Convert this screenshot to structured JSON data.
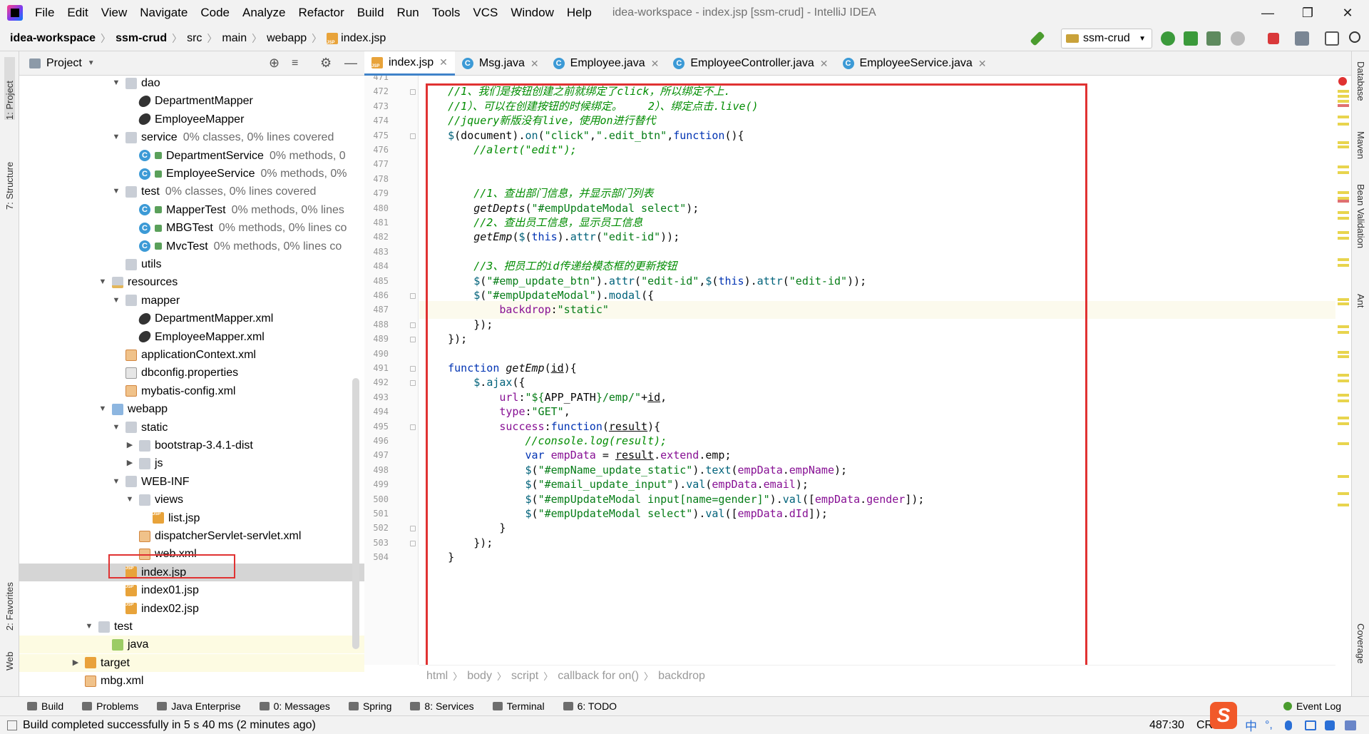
{
  "menu": {
    "items": [
      "File",
      "Edit",
      "View",
      "Navigate",
      "Code",
      "Analyze",
      "Refactor",
      "Build",
      "Run",
      "Tools",
      "VCS",
      "Window",
      "Help"
    ],
    "window_title": "idea-workspace - index.jsp [ssm-crud] - IntelliJ IDEA"
  },
  "nav": {
    "breadcrumb": [
      "idea-workspace",
      "ssm-crud",
      "src",
      "main",
      "webapp",
      "index.jsp"
    ],
    "run_config": "ssm-crud"
  },
  "left_strip": {
    "project": "1: Project",
    "structure": "7: Structure",
    "favorites": "2: Favorites",
    "web": "Web"
  },
  "right_strip": {
    "database": "Database",
    "maven": "Maven",
    "bean_validation": "Bean Validation",
    "ant": "Ant",
    "coverage": "Coverage"
  },
  "project_panel": {
    "title": "Project",
    "rows": [
      {
        "indent": 1,
        "arrow": "down",
        "icon": "folder",
        "label": "dao",
        "meta": ""
      },
      {
        "indent": 2,
        "arrow": "",
        "icon": "mapper",
        "label": "DepartmentMapper",
        "meta": ""
      },
      {
        "indent": 2,
        "arrow": "",
        "icon": "mapper",
        "label": "EmployeeMapper",
        "meta": ""
      },
      {
        "indent": 1,
        "arrow": "down",
        "icon": "folder",
        "label": "service",
        "meta": "0% classes, 0% lines covered"
      },
      {
        "indent": 2,
        "arrow": "",
        "icon": "class",
        "label": "DepartmentService",
        "meta": "0% methods, 0"
      },
      {
        "indent": 2,
        "arrow": "",
        "icon": "class",
        "label": "EmployeeService",
        "meta": "0% methods, 0%"
      },
      {
        "indent": 1,
        "arrow": "down",
        "icon": "folder",
        "label": "test",
        "meta": "0% classes, 0% lines covered"
      },
      {
        "indent": 2,
        "arrow": "",
        "icon": "class",
        "label": "MapperTest",
        "meta": "0% methods, 0% lines"
      },
      {
        "indent": 2,
        "arrow": "",
        "icon": "class",
        "label": "MBGTest",
        "meta": "0% methods, 0% lines co"
      },
      {
        "indent": 2,
        "arrow": "",
        "icon": "class",
        "label": "MvcTest",
        "meta": "0% methods, 0% lines co"
      },
      {
        "indent": 1,
        "arrow": "",
        "icon": "folder",
        "label": "utils",
        "meta": ""
      },
      {
        "indent": 0,
        "arrow": "down",
        "icon": "folder-res",
        "label": "resources",
        "meta": ""
      },
      {
        "indent": 1,
        "arrow": "down",
        "icon": "folder",
        "label": "mapper",
        "meta": ""
      },
      {
        "indent": 2,
        "arrow": "",
        "icon": "mapper",
        "label": "DepartmentMapper.xml",
        "meta": ""
      },
      {
        "indent": 2,
        "arrow": "",
        "icon": "mapper",
        "label": "EmployeeMapper.xml",
        "meta": ""
      },
      {
        "indent": 1,
        "arrow": "",
        "icon": "xml",
        "label": "applicationContext.xml",
        "meta": ""
      },
      {
        "indent": 1,
        "arrow": "",
        "icon": "props",
        "label": "dbconfig.properties",
        "meta": ""
      },
      {
        "indent": 1,
        "arrow": "",
        "icon": "xml",
        "label": "mybatis-config.xml",
        "meta": ""
      },
      {
        "indent": 0,
        "arrow": "down",
        "icon": "folder-src",
        "label": "webapp",
        "meta": ""
      },
      {
        "indent": 1,
        "arrow": "down",
        "icon": "folder",
        "label": "static",
        "meta": ""
      },
      {
        "indent": 2,
        "arrow": "right",
        "icon": "folder",
        "label": "bootstrap-3.4.1-dist",
        "meta": ""
      },
      {
        "indent": 2,
        "arrow": "right",
        "icon": "folder",
        "label": "js",
        "meta": ""
      },
      {
        "indent": 1,
        "arrow": "down",
        "icon": "folder",
        "label": "WEB-INF",
        "meta": ""
      },
      {
        "indent": 2,
        "arrow": "down",
        "icon": "folder",
        "label": "views",
        "meta": ""
      },
      {
        "indent": 3,
        "arrow": "",
        "icon": "jsp",
        "label": "list.jsp",
        "meta": ""
      },
      {
        "indent": 2,
        "arrow": "",
        "icon": "xml",
        "label": "dispatcherServlet-servlet.xml",
        "meta": ""
      },
      {
        "indent": 2,
        "arrow": "",
        "icon": "xml",
        "label": "web.xml",
        "meta": ""
      },
      {
        "indent": 1,
        "arrow": "",
        "icon": "jsp",
        "label": "index.jsp",
        "meta": "",
        "selected": true
      },
      {
        "indent": 1,
        "arrow": "",
        "icon": "jsp",
        "label": "index01.jsp",
        "meta": ""
      },
      {
        "indent": 1,
        "arrow": "",
        "icon": "jsp",
        "label": "index02.jsp",
        "meta": ""
      },
      {
        "indent": -1,
        "arrow": "down",
        "icon": "folder",
        "label": "test",
        "meta": ""
      },
      {
        "indent": 0,
        "arrow": "",
        "icon": "folder-green",
        "label": "java",
        "meta": "",
        "green": true
      },
      {
        "indent": -2,
        "arrow": "right",
        "icon": "folder-orange",
        "label": "target",
        "meta": "",
        "green": true
      },
      {
        "indent": -2,
        "arrow": "",
        "icon": "xml",
        "label": "mbg.xml",
        "meta": ""
      }
    ]
  },
  "tabs": [
    {
      "label": "index.jsp",
      "icon": "jsp",
      "active": true
    },
    {
      "label": "Msg.java",
      "icon": "class",
      "active": false
    },
    {
      "label": "Employee.java",
      "icon": "class",
      "active": false
    },
    {
      "label": "EmployeeController.java",
      "icon": "class",
      "active": false
    },
    {
      "label": "EmployeeService.java",
      "icon": "class",
      "active": false
    }
  ],
  "editor": {
    "current_line": 487,
    "lines": [
      {
        "n": "471",
        "t": [
          [
            "tx",
            ""
          ]
        ]
      },
      {
        "n": "472",
        "t": [
          [
            "cm",
            "    //1、我们是按钮创建之前就绑定了click，所以绑定不上."
          ]
        ]
      },
      {
        "n": "473",
        "t": [
          [
            "cm",
            "    //1）、可以在创建按钮的时候绑定。    2）、绑定点击.live()"
          ]
        ]
      },
      {
        "n": "474",
        "t": [
          [
            "cm",
            "    //jquery新版没有live，使用on进行替代"
          ]
        ]
      },
      {
        "n": "475",
        "t": [
          [
            "fn",
            "    $"
          ],
          [
            "tx",
            "(document)."
          ],
          [
            "fn",
            "on"
          ],
          [
            "tx",
            "("
          ],
          [
            "str",
            "\"click\""
          ],
          [
            "tx",
            ","
          ],
          [
            "str",
            "\".edit_btn\""
          ],
          [
            "tx",
            ","
          ],
          [
            "kw",
            "function"
          ],
          [
            "tx",
            "(){"
          ]
        ]
      },
      {
        "n": "476",
        "t": [
          [
            "cm",
            "        //alert(\"edit\");"
          ]
        ]
      },
      {
        "n": "477",
        "t": [
          [
            "tx",
            ""
          ]
        ]
      },
      {
        "n": "478",
        "t": [
          [
            "tx",
            ""
          ]
        ]
      },
      {
        "n": "479",
        "t": [
          [
            "cm",
            "        //1、查出部门信息，并显示部门列表"
          ]
        ]
      },
      {
        "n": "480",
        "t": [
          [
            "tx",
            "        "
          ],
          [
            "it",
            "getDepts"
          ],
          [
            "tx",
            "("
          ],
          [
            "str",
            "\"#empUpdateModal select\""
          ],
          [
            "tx",
            ");"
          ]
        ]
      },
      {
        "n": "481",
        "t": [
          [
            "cm",
            "        //2、查出员工信息，显示员工信息"
          ]
        ]
      },
      {
        "n": "482",
        "t": [
          [
            "tx",
            "        "
          ],
          [
            "it",
            "getEmp"
          ],
          [
            "tx",
            "("
          ],
          [
            "fn",
            "$"
          ],
          [
            "tx",
            "("
          ],
          [
            "kw",
            "this"
          ],
          [
            "tx",
            ")."
          ],
          [
            "fn",
            "attr"
          ],
          [
            "tx",
            "("
          ],
          [
            "str",
            "\"edit-id\""
          ],
          [
            "tx",
            "));"
          ]
        ]
      },
      {
        "n": "483",
        "t": [
          [
            "tx",
            ""
          ]
        ]
      },
      {
        "n": "484",
        "t": [
          [
            "cm",
            "        //3、把员工的id传递给模态框的更新按钮"
          ]
        ]
      },
      {
        "n": "485",
        "t": [
          [
            "fn",
            "        $"
          ],
          [
            "tx",
            "("
          ],
          [
            "str",
            "\"#emp_update_btn\""
          ],
          [
            "tx",
            ")."
          ],
          [
            "fn",
            "attr"
          ],
          [
            "tx",
            "("
          ],
          [
            "str",
            "\"edit-id\""
          ],
          [
            "tx",
            ","
          ],
          [
            "fn",
            "$"
          ],
          [
            "tx",
            "("
          ],
          [
            "kw",
            "this"
          ],
          [
            "tx",
            ")."
          ],
          [
            "fn",
            "attr"
          ],
          [
            "tx",
            "("
          ],
          [
            "str",
            "\"edit-id\""
          ],
          [
            "tx",
            "));"
          ]
        ]
      },
      {
        "n": "486",
        "t": [
          [
            "fn",
            "        $"
          ],
          [
            "tx",
            "("
          ],
          [
            "str",
            "\"#empUpdateModal\""
          ],
          [
            "tx",
            ")."
          ],
          [
            "fn",
            "modal"
          ],
          [
            "tx",
            "({"
          ]
        ]
      },
      {
        "n": "487",
        "t": [
          [
            "tx",
            "            "
          ],
          [
            "mb",
            "backdrop"
          ],
          [
            "tx",
            ":"
          ],
          [
            "str",
            "\"static\""
          ]
        ]
      },
      {
        "n": "488",
        "t": [
          [
            "tx",
            "        });"
          ]
        ]
      },
      {
        "n": "489",
        "t": [
          [
            "tx",
            "    });"
          ]
        ]
      },
      {
        "n": "490",
        "t": [
          [
            "tx",
            ""
          ]
        ]
      },
      {
        "n": "491",
        "t": [
          [
            "kw",
            "    function "
          ],
          [
            "it",
            "getEmp"
          ],
          [
            "tx",
            "("
          ],
          [
            "ul",
            "id"
          ],
          [
            "tx",
            "){"
          ]
        ]
      },
      {
        "n": "492",
        "t": [
          [
            "fn",
            "        $"
          ],
          [
            "tx",
            "."
          ],
          [
            "fn",
            "ajax"
          ],
          [
            "tx",
            "({"
          ]
        ]
      },
      {
        "n": "493",
        "t": [
          [
            "mb",
            "            url"
          ],
          [
            "tx",
            ":"
          ],
          [
            "str",
            "\"${"
          ],
          [
            "tx",
            "APP_PATH"
          ],
          [
            "str",
            "}/emp/\""
          ],
          [
            "tx",
            "+"
          ],
          [
            "ul",
            "id"
          ],
          [
            "tx",
            ","
          ]
        ]
      },
      {
        "n": "494",
        "t": [
          [
            "mb",
            "            type"
          ],
          [
            "tx",
            ":"
          ],
          [
            "str",
            "\"GET\""
          ],
          [
            "tx",
            ","
          ]
        ]
      },
      {
        "n": "495",
        "t": [
          [
            "mb",
            "            success"
          ],
          [
            "tx",
            ":"
          ],
          [
            "kw",
            "function"
          ],
          [
            "tx",
            "("
          ],
          [
            "ul",
            "result"
          ],
          [
            "tx",
            "){"
          ]
        ]
      },
      {
        "n": "496",
        "t": [
          [
            "cm",
            "                //console.log(result);"
          ]
        ]
      },
      {
        "n": "497",
        "t": [
          [
            "kw",
            "                var "
          ],
          [
            "mb",
            "empData"
          ],
          [
            "tx",
            " = "
          ],
          [
            "ul",
            "result"
          ],
          [
            "tx",
            "."
          ],
          [
            "mb",
            "extend"
          ],
          [
            "tx",
            ".emp;"
          ]
        ]
      },
      {
        "n": "498",
        "t": [
          [
            "fn",
            "                $"
          ],
          [
            "tx",
            "("
          ],
          [
            "str",
            "\"#empName_update_static\""
          ],
          [
            "tx",
            ")."
          ],
          [
            "fn",
            "text"
          ],
          [
            "tx",
            "("
          ],
          [
            "mb",
            "empData"
          ],
          [
            "tx",
            "."
          ],
          [
            "mb",
            "empName"
          ],
          [
            "tx",
            ");"
          ]
        ]
      },
      {
        "n": "499",
        "t": [
          [
            "fn",
            "                $"
          ],
          [
            "tx",
            "("
          ],
          [
            "str",
            "\"#email_update_input\""
          ],
          [
            "tx",
            ")."
          ],
          [
            "fn",
            "val"
          ],
          [
            "tx",
            "("
          ],
          [
            "mb",
            "empData"
          ],
          [
            "tx",
            "."
          ],
          [
            "mb",
            "email"
          ],
          [
            "tx",
            ");"
          ]
        ]
      },
      {
        "n": "500",
        "t": [
          [
            "fn",
            "                $"
          ],
          [
            "tx",
            "("
          ],
          [
            "str",
            "\"#empUpdateModal input[name=gender]\""
          ],
          [
            "tx",
            ")."
          ],
          [
            "fn",
            "val"
          ],
          [
            "tx",
            "(["
          ],
          [
            "mb",
            "empData"
          ],
          [
            "tx",
            "."
          ],
          [
            "mb",
            "gender"
          ],
          [
            "tx",
            "]);"
          ]
        ]
      },
      {
        "n": "501",
        "t": [
          [
            "fn",
            "                $"
          ],
          [
            "tx",
            "("
          ],
          [
            "str",
            "\"#empUpdateModal select\""
          ],
          [
            "tx",
            ")."
          ],
          [
            "fn",
            "val"
          ],
          [
            "tx",
            "(["
          ],
          [
            "mb",
            "empData"
          ],
          [
            "tx",
            "."
          ],
          [
            "mb",
            "dId"
          ],
          [
            "tx",
            "]);"
          ]
        ]
      },
      {
        "n": "502",
        "t": [
          [
            "tx",
            "            }"
          ]
        ]
      },
      {
        "n": "503",
        "t": [
          [
            "tx",
            "        });"
          ]
        ]
      },
      {
        "n": "504",
        "t": [
          [
            "tx",
            "    }"
          ]
        ]
      }
    ],
    "breadcrumb": [
      "html",
      "body",
      "script",
      "callback for on()",
      "backdrop"
    ]
  },
  "bottom_tabs": [
    "Build",
    "Problems",
    "Java Enterprise",
    "0: Messages",
    "Spring",
    "8: Services",
    "Terminal",
    "6: TODO"
  ],
  "event_log": "Event Log",
  "status": {
    "message": "Build completed successfully in 5 s 40 ms (2 minutes ago)",
    "position": "487:30",
    "encoding": "CRL",
    "ime_cn": "中"
  },
  "colors": {
    "highlight_box": "#e03232",
    "comment": "#008c00",
    "string": "#067d17",
    "keyword": "#0033b3"
  }
}
